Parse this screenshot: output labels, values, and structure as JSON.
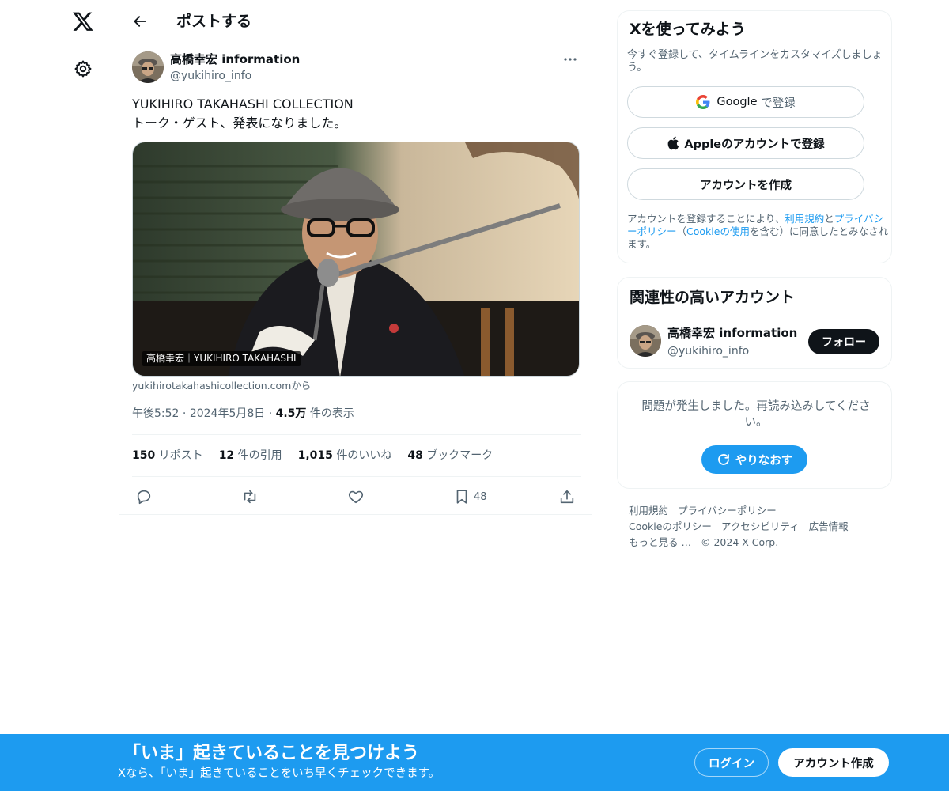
{
  "nav": {
    "logo_icon": "x-logo-icon",
    "settings_icon": "gear-icon"
  },
  "header": {
    "back_icon": "arrow-left-icon",
    "title": "ポストする"
  },
  "post": {
    "author_name": "高橋幸宏 information",
    "author_handle": "@yukihiro_info",
    "text_line1": "YUKIHIRO TAKAHASHI COLLECTION",
    "text_line2": "トーク・ゲスト、発表になりました。",
    "image_caption": "高橋幸宏｜YUKIHIRO TAKAHASHI",
    "source": "yukihirotakahashicollection.comから",
    "time": "午後5:52",
    "date": "2024年5月8日",
    "views_count": "4.5万",
    "views_label": "件の表示",
    "stats": {
      "reposts_count": "150",
      "reposts_label": "リポスト",
      "quotes_count": "12",
      "quotes_label": "件の引用",
      "likes_count": "1,015",
      "likes_label": "件のいいね",
      "bookmarks_count": "48",
      "bookmarks_label": "ブックマーク"
    },
    "bookmark_action_count": "48"
  },
  "signup_card": {
    "title": "Xを使ってみよう",
    "subtitle": "今すぐ登録して、タイムラインをカスタマイズしましょう。",
    "google_label": "Google",
    "google_suffix": "で登録",
    "apple_label": "Appleのアカウントで登録",
    "create_label": "アカウントを作成",
    "legal_1": "アカウントを登録することにより、",
    "legal_terms": "利用規約",
    "legal_2": "と",
    "legal_privacy": "プライバシーポリシー",
    "legal_3": "（",
    "legal_cookie": "Cookieの使用",
    "legal_4": "を含む）に同意したとみなされます。"
  },
  "related_card": {
    "title": "関連性の高いアカウント",
    "name": "高橋幸宏 information",
    "handle": "@yukihiro_info",
    "follow_label": "フォロー"
  },
  "error_card": {
    "message": "問題が発生しました。再読み込みしてください。",
    "retry_label": "やりなおす"
  },
  "footer": {
    "terms": "利用規約",
    "privacy": "プライバシーポリシー",
    "cookie": "Cookieのポリシー",
    "accessibility": "アクセシビリティ",
    "ads": "広告情報",
    "more": "もっと見る …",
    "copyright": "© 2024 X Corp."
  },
  "banner": {
    "title": "「いま」起きていることを見つけよう",
    "subtitle": "Xなら、「いま」起きていることをいち早くチェックできます。",
    "login_label": "ログイン",
    "signup_label": "アカウント作成"
  },
  "colors": {
    "accent": "#1d9bf0",
    "text": "#0f1419",
    "secondary_text": "#536471",
    "border": "#eff3f4"
  }
}
